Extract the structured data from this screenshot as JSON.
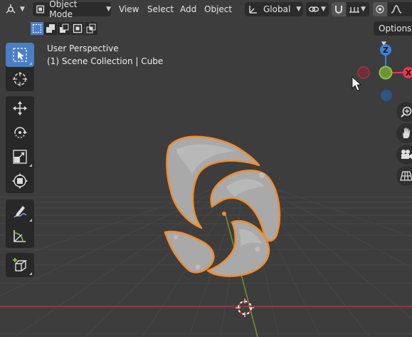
{
  "header": {
    "mode_label": "Object Mode",
    "menus": [
      "View",
      "Select",
      "Add",
      "Object"
    ],
    "orientation_label": "Global"
  },
  "options_label": "Options",
  "viewport": {
    "view_name": "User Perspective",
    "collection_info": "(1) Scene Collection | Cube"
  },
  "gizmo": {
    "z_label": "Z",
    "x_label": "X"
  },
  "colors": {
    "background": "#3d3d3d",
    "grid": "#474747",
    "x_axis": "#a3393e",
    "y_axis": "#6e9432",
    "selection_outline": "#f28c28",
    "active_tool": "#4a7ec6",
    "gizmo_x": "#e03a52",
    "gizmo_y": "#8bc34a",
    "gizmo_z": "#3a86d8"
  }
}
